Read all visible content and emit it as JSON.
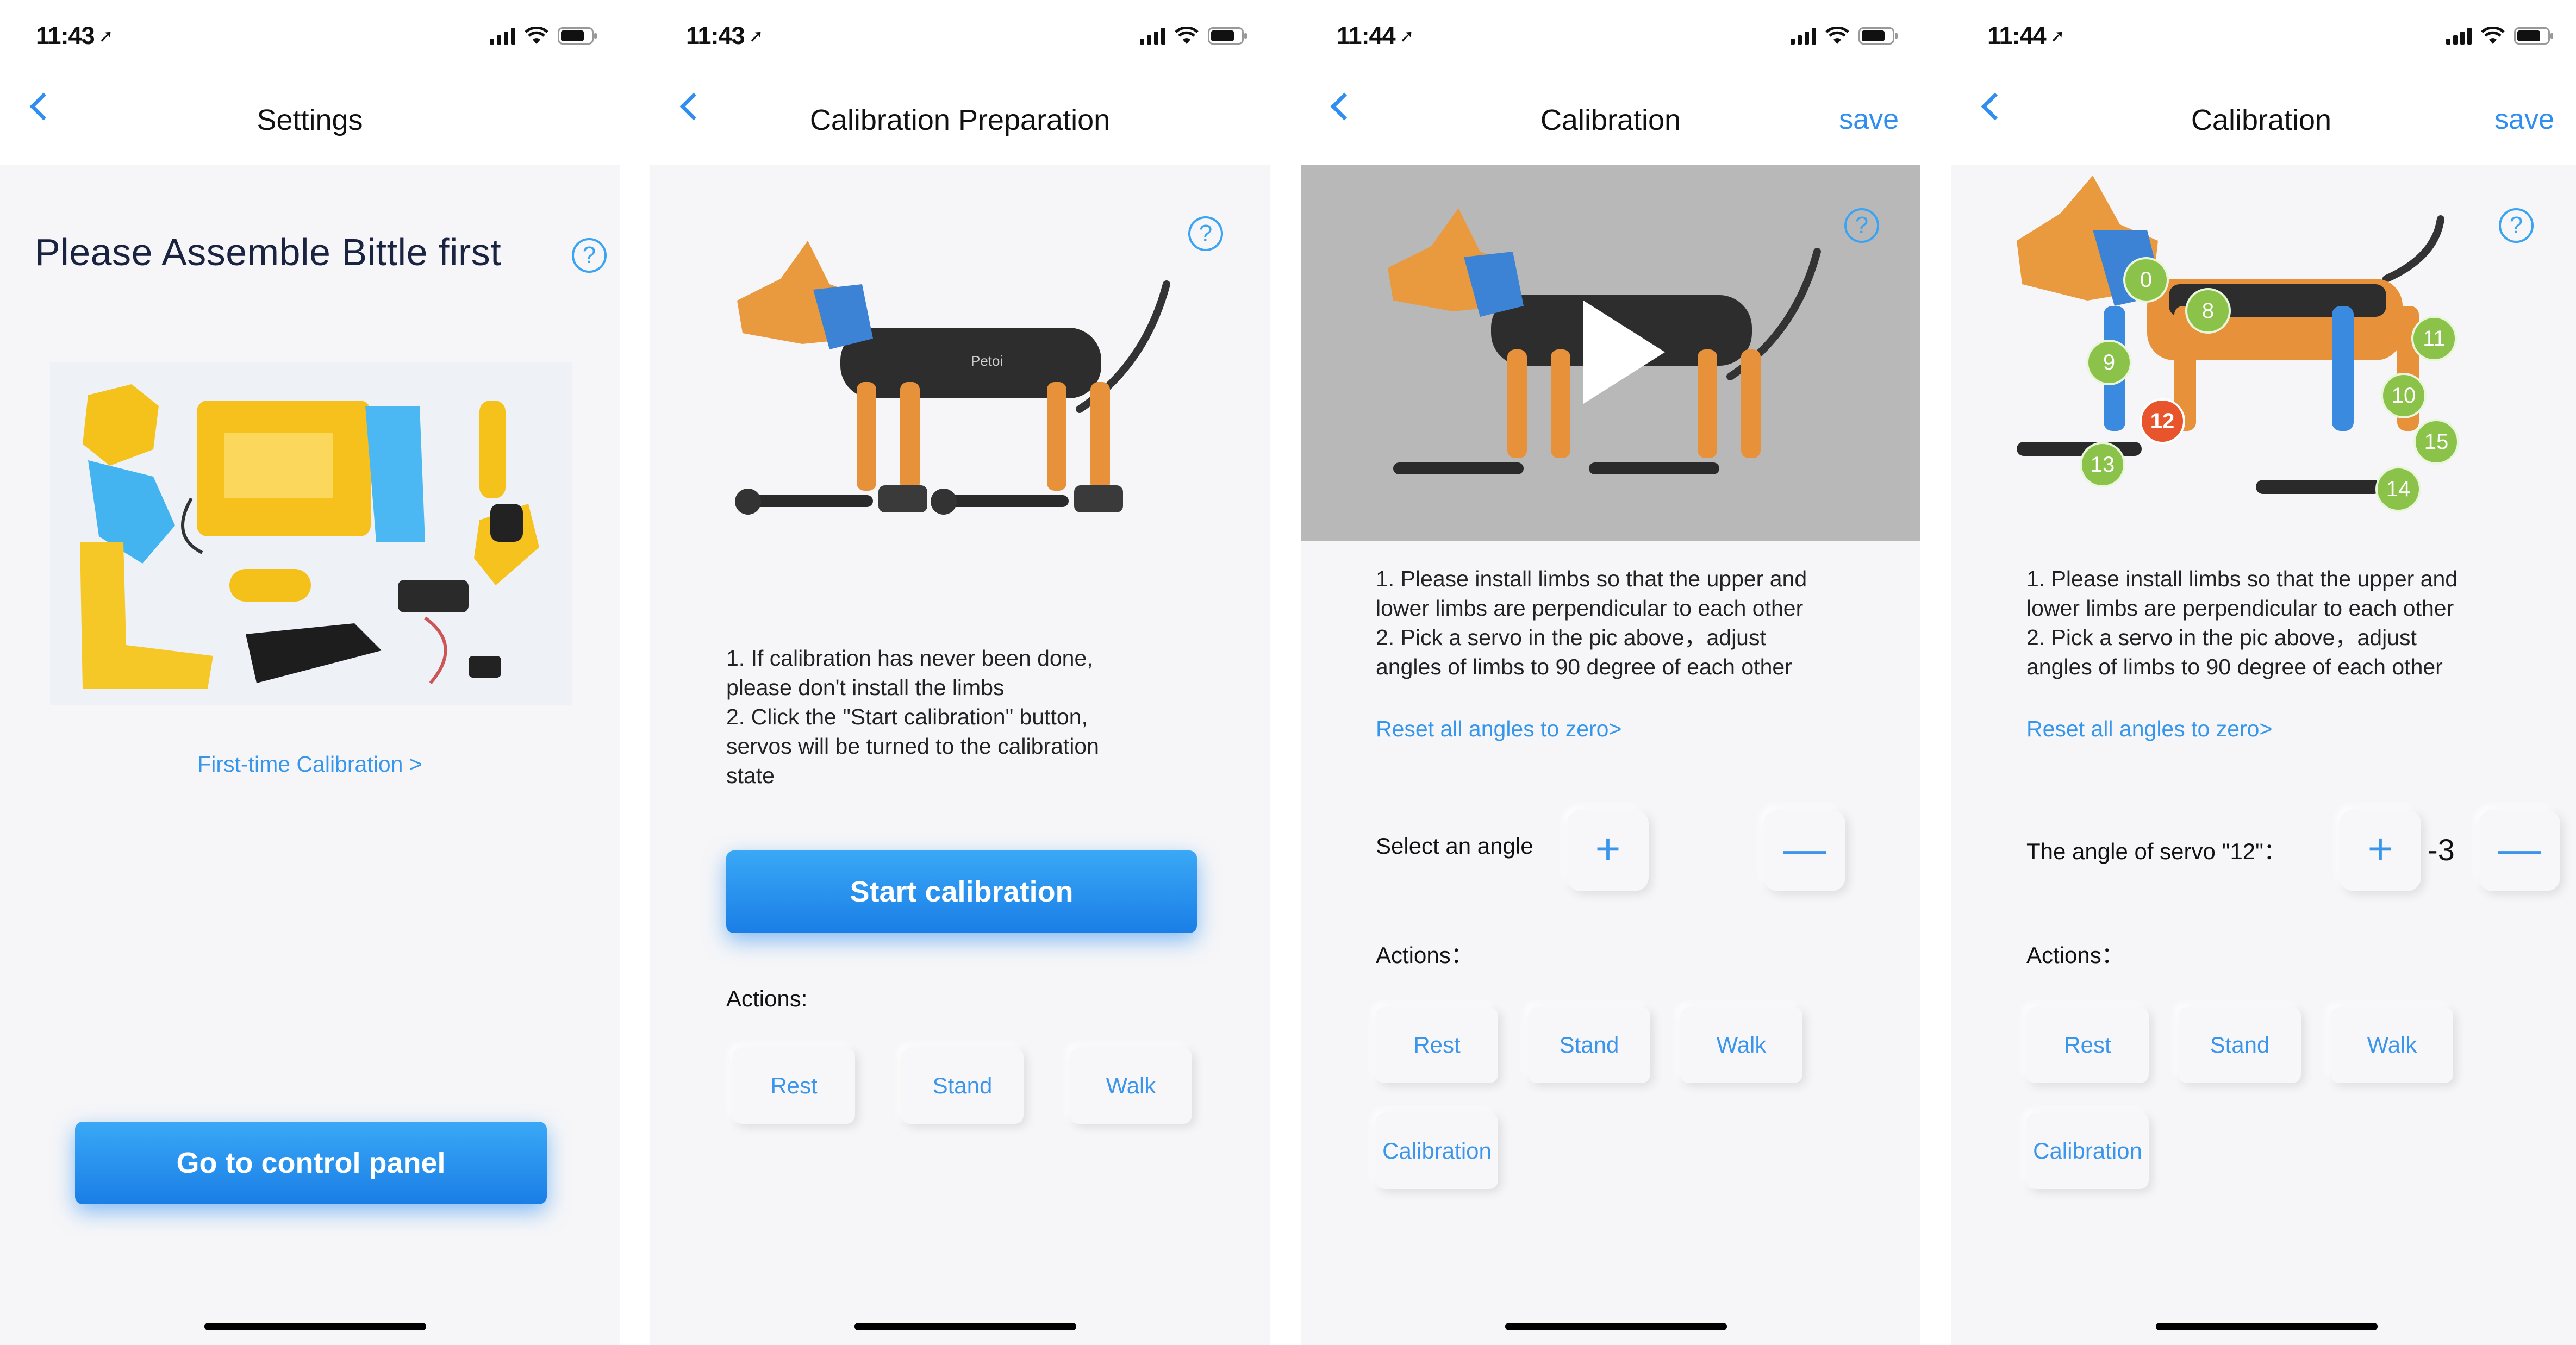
{
  "status_times": [
    "11:43",
    "11:43",
    "11:44",
    "11:44"
  ],
  "screen1": {
    "title": "Settings",
    "heading": "Please Assemble Bittle first",
    "link": "First-time Calibration >",
    "button": "Go to control panel"
  },
  "screen2": {
    "title": "Calibration Preparation",
    "instructions": [
      "1. If calibration has never been done,",
      "please don't install the limbs",
      "2. Click the \"Start calibration\" button,",
      "servos will be turned to the calibration",
      "state"
    ],
    "button": "Start calibration",
    "actions_label": "Actions:",
    "actions": [
      "Rest",
      "Stand",
      "Walk"
    ]
  },
  "screen3": {
    "title": "Calibration",
    "save": "save",
    "instructions": [
      "1. Please install limbs so that the upper and",
      "lower limbs are perpendicular to each other",
      "2. Pick a servo in the pic above，adjust",
      "angles of limbs to 90 degree of each other"
    ],
    "reset": "Reset all angles to zero>",
    "select_label": "Select an angle",
    "plus": "+",
    "minus": "—",
    "actions_label": "Actions：",
    "actions": [
      "Rest",
      "Stand",
      "Walk",
      "Calibration"
    ]
  },
  "screen4": {
    "title": "Calibration",
    "save": "save",
    "instructions": [
      "1. Please install limbs so that the upper and",
      "lower limbs are perpendicular to each other",
      "2. Pick a servo in the pic above，adjust",
      "angles of limbs to 90 degree of each other"
    ],
    "reset": "Reset all angles to zero>",
    "angle_label": "The angle of servo \"12\"：",
    "angle_value": "-3",
    "plus": "+",
    "minus": "—",
    "actions_label": "Actions：",
    "actions": [
      "Rest",
      "Stand",
      "Walk",
      "Calibration"
    ],
    "servos": [
      "0",
      "8",
      "9",
      "11",
      "10",
      "12",
      "15",
      "13",
      "14"
    ],
    "selected_servo": "12"
  },
  "robot_label": "Petoi",
  "help_glyph": "?",
  "icons": [
    "back-chevron-icon",
    "help-icon",
    "signal-icon",
    "wifi-icon",
    "battery-icon",
    "location-arrow-icon",
    "play-icon"
  ]
}
